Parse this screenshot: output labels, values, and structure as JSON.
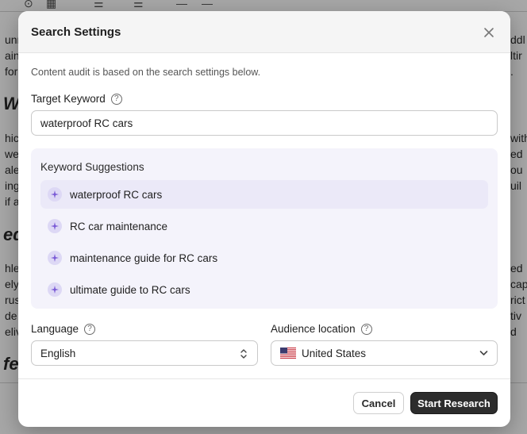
{
  "modal": {
    "title": "Search Settings",
    "description": "Content audit is based on the search settings below."
  },
  "keyword": {
    "label": "Target Keyword",
    "value": "waterproof RC cars"
  },
  "suggestions": {
    "title": "Keyword Suggestions",
    "items": [
      {
        "label": "waterproof RC cars",
        "active": true
      },
      {
        "label": "RC car maintenance",
        "active": false
      },
      {
        "label": "maintenance guide for RC cars",
        "active": false
      },
      {
        "label": "ultimate guide to RC cars",
        "active": false
      }
    ]
  },
  "language": {
    "label": "Language",
    "value": "English"
  },
  "location": {
    "label": "Audience location",
    "value": "United States",
    "flag": "us-flag-icon"
  },
  "buttons": {
    "cancel": "Cancel",
    "start": "Start Research"
  },
  "background": {
    "heading_fragments": [
      "Wa",
      "ed",
      "fe"
    ],
    "left_fragments": [
      "unn",
      "aini",
      "for",
      "hicl",
      "wet",
      "ale",
      "ing",
      "if a",
      "hle",
      "ely",
      "rus",
      "de",
      "eliv"
    ],
    "right_fragments": [
      "ddl",
      "ltir",
      ".",
      "with",
      "ed",
      "ou",
      "uil",
      "ed",
      "cap",
      "rict",
      "tiv",
      "d"
    ]
  },
  "colors": {
    "primary_button": "#2d2d2d",
    "suggestion_bg": "#f4f3fb",
    "sparkle_accent": "#7b5cd6"
  }
}
